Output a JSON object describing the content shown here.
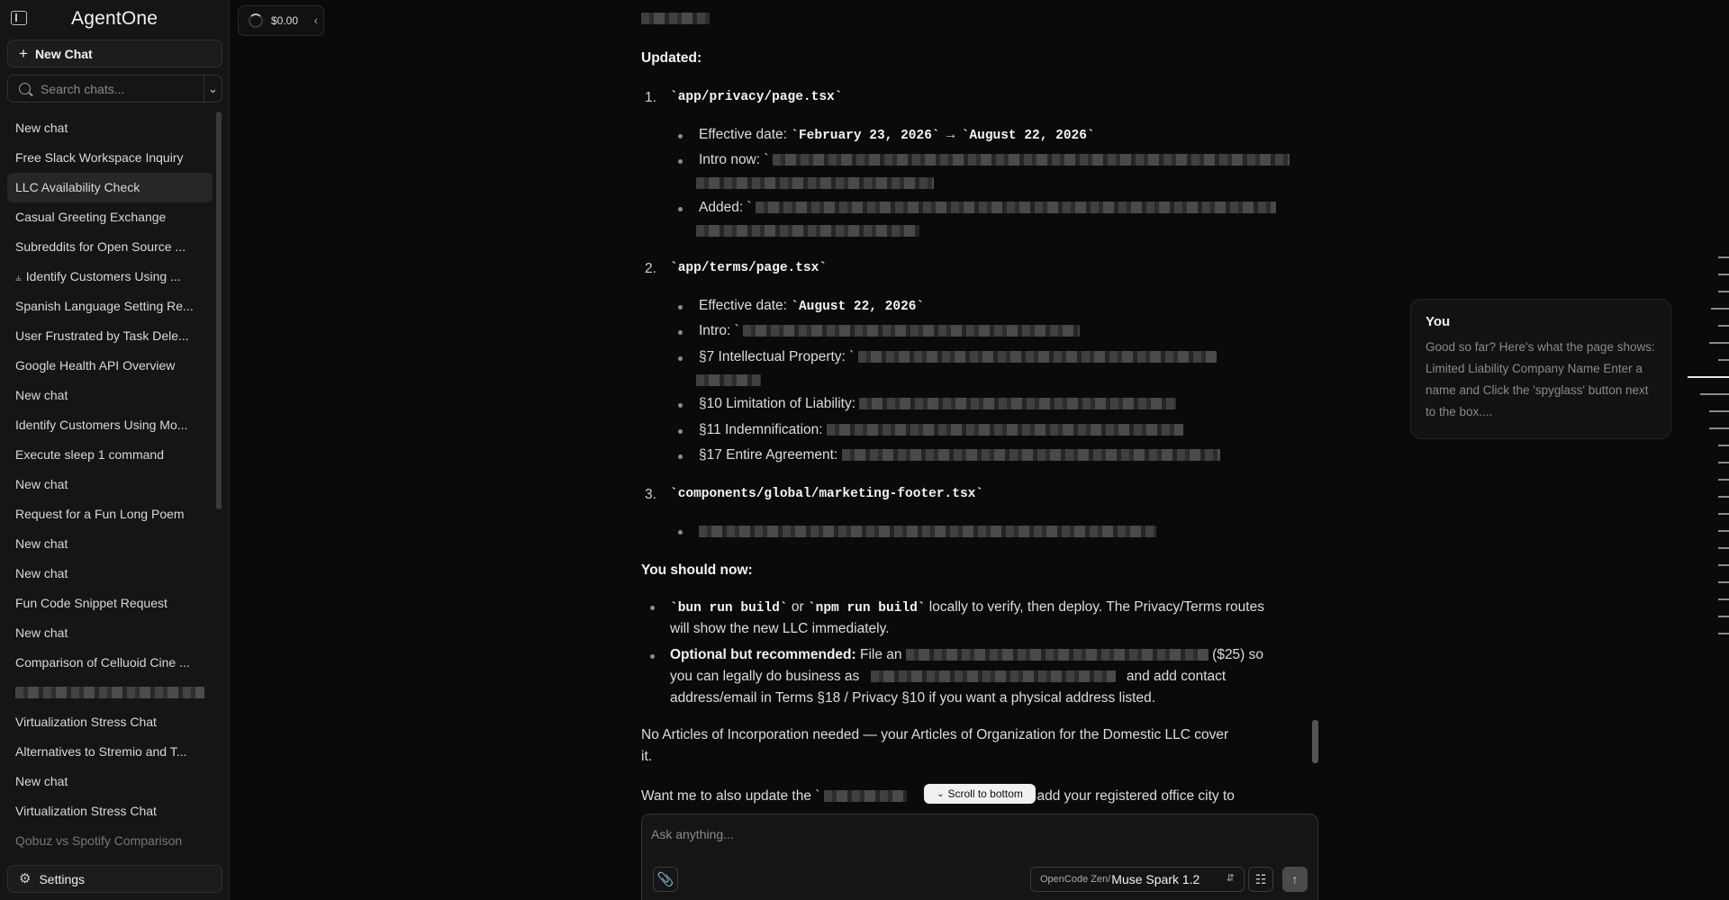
{
  "app": {
    "title": "AgentOne"
  },
  "sidebar": {
    "new_chat_label": "New Chat",
    "search_placeholder": "Search chats...",
    "settings_label": "Settings",
    "items": [
      {
        "label": "New chat"
      },
      {
        "label": "Free Slack Workspace Inquiry"
      },
      {
        "label": "LLC Availability Check",
        "active": true
      },
      {
        "label": "Casual Greeting Exchange"
      },
      {
        "label": "Subreddits for Open Source ..."
      },
      {
        "label": "Identify Customers Using ...",
        "forked": true
      },
      {
        "label": "Spanish Language Setting Re..."
      },
      {
        "label": "User Frustrated by Task Dele..."
      },
      {
        "label": "Google Health API Overview"
      },
      {
        "label": "New chat"
      },
      {
        "label": "Identify Customers Using Mo..."
      },
      {
        "label": "Execute sleep 1 command"
      },
      {
        "label": "New chat"
      },
      {
        "label": "Request for a Fun Long Poem"
      },
      {
        "label": "New chat"
      },
      {
        "label": "New chat"
      },
      {
        "label": "Fun Code Snippet Request"
      },
      {
        "label": "New chat"
      },
      {
        "label": "Comparison of Celluoid Cine ..."
      },
      {
        "label": "",
        "redacted": true
      },
      {
        "label": "Virtualization Stress Chat"
      },
      {
        "label": "Alternatives to Stremio and T..."
      },
      {
        "label": "New chat"
      },
      {
        "label": "Virtualization Stress Chat"
      },
      {
        "label": "Qobuz vs Spotify Comparison",
        "faded": true
      }
    ]
  },
  "cost": {
    "value": "$0.00"
  },
  "message": {
    "updated_heading": "Updated:",
    "files": [
      {
        "num": "1.",
        "path": "`app/privacy/page.tsx`",
        "bullets": {
          "effective_label": "Effective date:",
          "effective_from": "`February 23, 2026`",
          "arrow": "→",
          "effective_to": "`August 22, 2026`",
          "intro_label": "Intro now: `",
          "added_label": "Added: `"
        }
      },
      {
        "num": "2.",
        "path": "`app/terms/page.tsx`",
        "bullets": {
          "effective_label": "Effective date:",
          "effective_value": "`August 22, 2026`",
          "intro_label": "Intro: `",
          "ip_label": "§7 Intellectual Property: `",
          "liability_label": "§10 Limitation of Liability:",
          "indemn_label": "§11 Indemnification:",
          "entire_label": "§17 Entire Agreement:"
        }
      },
      {
        "num": "3.",
        "path": "`components/global/marketing-footer.tsx`"
      }
    ],
    "should_now_heading": "You should now:",
    "todo": {
      "build_cmd1": "`bun run build`",
      "build_or": "or",
      "build_cmd2": "`npm run build`",
      "build_rest": "locally to verify, then deploy. The Privacy/Terms routes",
      "build_line2": "will show the new LLC immediately.",
      "optional_bold": "Optional but recommended:",
      "optional_text": "File an",
      "optional_price": "($25) so",
      "optional_line2a": "you can legally do business as",
      "optional_line2b": "and add contact",
      "optional_line3": "address/email in Terms §18 / Privacy §10 if you want a physical address listed."
    },
    "no_articles": "No Articles of Incorporation needed — your Articles of Organization for the Domestic LLC cover",
    "no_articles_line2": "it.",
    "want_me_a": "Want me to also update the `",
    "want_me_b": "or add your registered office city to"
  },
  "scroll_to_bottom": "Scroll to bottom",
  "composer": {
    "placeholder": "Ask anything...",
    "model_provider": "OpenCode Zen/",
    "model_name": "Muse Spark 1.2"
  },
  "you_card": {
    "title": "You",
    "text": "Good so far? Here's what the page shows: Limited Liability Company Name Enter a name and Click the 'spyglass' button next to the box...."
  }
}
